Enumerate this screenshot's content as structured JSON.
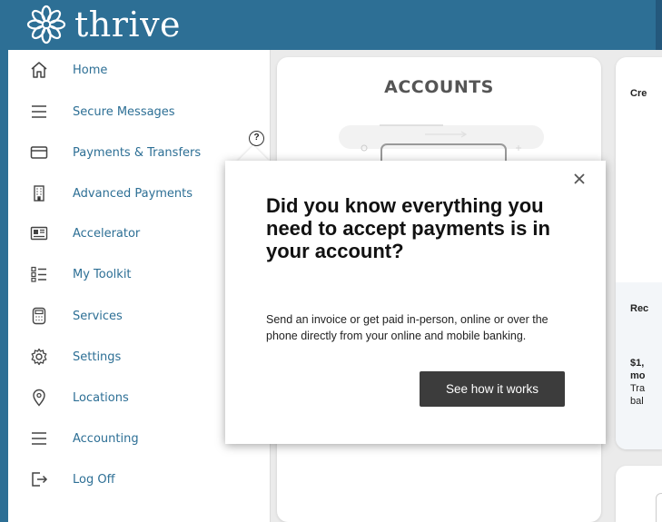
{
  "brand": {
    "name": "thrive",
    "logo_icon": "snowflake-flower-logo"
  },
  "sidebar": {
    "items": [
      {
        "label": "Home",
        "icon": "home-icon"
      },
      {
        "label": "Secure Messages",
        "icon": "menu-lines-icon"
      },
      {
        "label": "Payments & Transfers",
        "icon": "credit-card-icon"
      },
      {
        "label": "Advanced Payments",
        "icon": "building-icon"
      },
      {
        "label": "Accelerator",
        "icon": "newspaper-icon"
      },
      {
        "label": "My Toolkit",
        "icon": "checklist-icon"
      },
      {
        "label": "Services",
        "icon": "calculator-icon"
      },
      {
        "label": "Settings",
        "icon": "gear-icon"
      },
      {
        "label": "Locations",
        "icon": "location-pin-icon"
      },
      {
        "label": "Accounting",
        "icon": "menu-lines-icon"
      },
      {
        "label": "Log Off",
        "icon": "log-off-icon"
      }
    ],
    "help_badge": "?"
  },
  "main": {
    "accounts_card": {
      "title": "ACCOUNTS"
    },
    "right_card": {
      "top_text": "Cre",
      "lower_heading": "Rec",
      "amount_line": "$1,",
      "amount_line2": "mo",
      "desc_line1": "Tra",
      "desc_line2": "bal"
    }
  },
  "popover": {
    "title": "Did you know everything you need to accept payments is in your account?",
    "body": "Send an invoice or get paid in-person, online or over the phone directly from your online and mobile banking.",
    "cta_label": "See how it works",
    "close_icon": "close-icon"
  },
  "colors": {
    "brand_blue": "#2d6f95",
    "nav_text": "#2d6f95",
    "cta_bg": "#3c3c3c",
    "page_bg": "#ebebeb"
  }
}
